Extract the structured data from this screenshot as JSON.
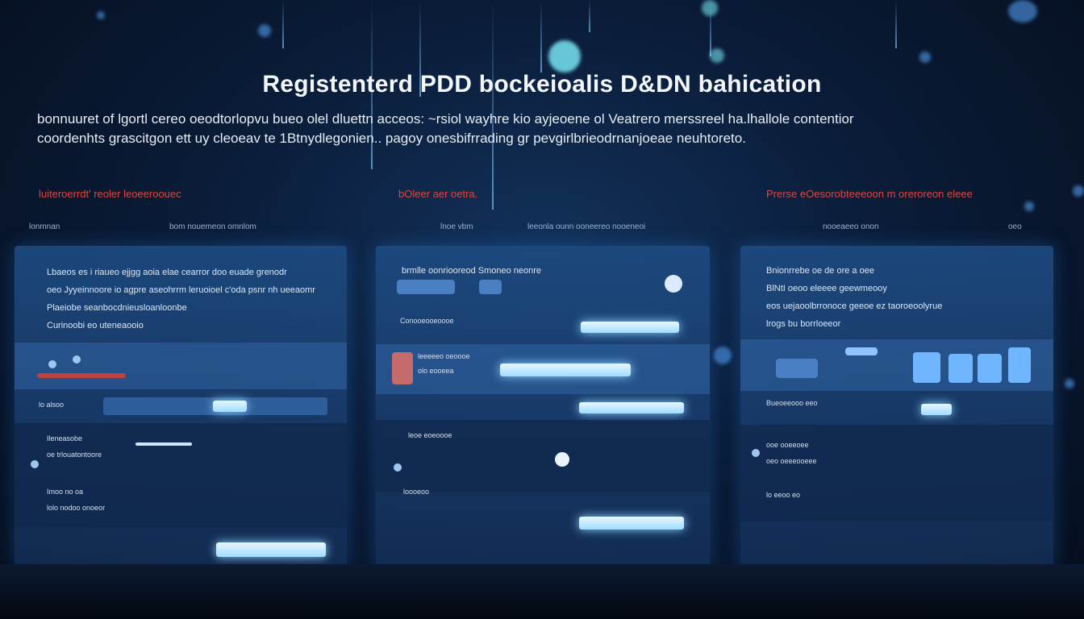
{
  "hero": {
    "title": "Registenterd PDD bockeioalis D&DN bahication",
    "description_line1": "bonnuuret of lgortl cereo oeodtorlopvu bueo olel dluettn acceos: ~rsiol wayhre kio ayjeoene ol Veatrero merssreel ha.lhallole contentior",
    "description_line2": "coordenhts grascitgon ett uy cleoeav te 1Btnydlegonien.. pagoy onesbifrrading gr pevgirlbrieodrnanjoeae neuhtoreto."
  },
  "columns": [
    {
      "heading": "luiteroerrdt' reoler leoeeroouec",
      "subtext_left": "lonmnan",
      "subtext_right": "bom nouemeon omnlom",
      "panel_lines": [
        "Lbaeos es i riaueo ejjgg aoia elae cearror doo euade grenodr",
        "oeo Jyyeinnoore io agpre aseohrrm leruoioel c'oda psnr nh ueeaomr",
        "Plaeiobe seanbocdnieusloanloonbe",
        "Curinoobi eo uteneaooio"
      ],
      "field_label": "lo alsoo",
      "rows": [
        "Ileneasobe",
        "oe trlouatontoore",
        "Imoo no oa",
        "lolo nodoo onoeor"
      ],
      "button_label": ""
    },
    {
      "heading": "bOleer aer oetra.",
      "subtext_left": "lnoe vbm",
      "subtext_right": "leeonla ounn  ooneereo nooeneoi",
      "panel_lines": [
        "brmlle oonriooreod Smoneo neonre",
        "Conooeooeoooe"
      ],
      "rows": [
        "leeeeeo oeoooe",
        "olo eooeea",
        "leoe eoeoooe",
        "loooeoo"
      ],
      "button_label": ""
    },
    {
      "heading": "Prerse eOesorobteeeoon m oreroreon eleee",
      "subtext_left": "nooeaeeo onon",
      "subtext_right": "oeo",
      "panel_lines": [
        "Bnionrrebe oe de ore a oee",
        "BlNtI oeoo eleeee geewmeooy",
        "eos uejaoolbrronoce geeoe ez taoroeoolyrue",
        "lrogs bu borrloeeor"
      ],
      "rows": [
        "Bueoeeooo eeo",
        "ooe ooeeoee",
        "oeo oeeeooeee",
        "lo eeoo eo"
      ],
      "button_label": ""
    }
  ],
  "colors": {
    "accent_red": "#e0463f",
    "glow_cyan": "#9fdcff",
    "panel_blue": "#1d4a80"
  }
}
